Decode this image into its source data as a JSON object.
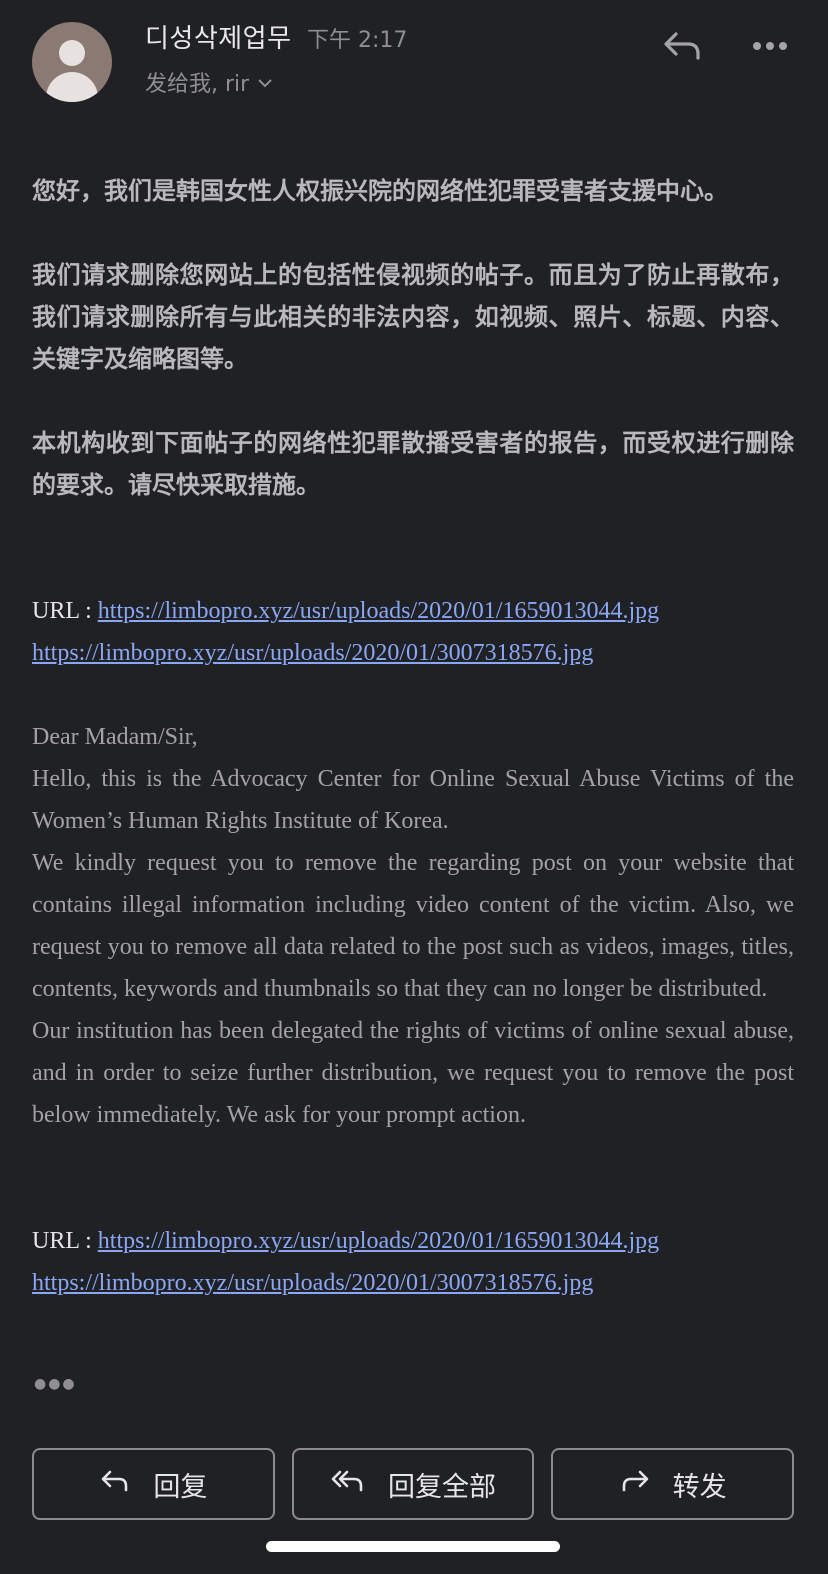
{
  "header": {
    "sender": "디성삭제업무",
    "time": "下午 2:17",
    "recipients": "发给我, rir",
    "icons": [
      "person-avatar",
      "reply-icon",
      "more-icon",
      "chevron-down-icon"
    ]
  },
  "body": {
    "cn_p1": "您好，我们是韩国女性人权振兴院的网络性犯罪受害者支援中心。",
    "cn_p2": "我们请求删除您网站上的包括性侵视频的帖子。而且为了防止再散布，我们请求删除所有与此相关的非法内容，如视频、照片、标题、内容、关键字及缩略图等。",
    "cn_p3": "本机构收到下面帖子的网络性犯罪散播受害者的报告，而受权进行删除的要求。请尽快采取措施。",
    "url_label": "URL : ",
    "url1": "https://limbopro.xyz/usr/uploads/2020/01/1659013044.jpg",
    "url2": "https://limbopro.xyz/usr/uploads/2020/01/3007318576.jpg",
    "en_greeting": "Dear Madam/Sir,",
    "en_p1": "Hello, this is the Advocacy Center for Online Sexual Abuse Victims of the Women’s Human Rights Institute of Korea.",
    "en_p2": "We kindly request you to remove the regarding post on your website that contains illegal information including video content of the victim. Also, we request you to remove all data related to the post such as videos, images, titles, contents, keywords and thumbnails so that they can no longer be distributed.",
    "en_p3": "Our institution has been delegated the rights of victims of online sexual abuse, and in order to seize further distribution, we request you to remove the post below immediately. We ask for your prompt action.",
    "url_label_2": "URL : ",
    "url3": "https://limbopro.xyz/usr/uploads/2020/01/1659013044.jpg",
    "url4": "https://limbopro.xyz/usr/uploads/2020/01/3007318576.jpg",
    "dots": "●●●"
  },
  "actions": {
    "reply": "回复",
    "reply_all": "回复全部",
    "forward": "转发"
  },
  "colors": {
    "background": "#202124",
    "link": "#8aa7f5",
    "border": "#8a8a8f"
  }
}
